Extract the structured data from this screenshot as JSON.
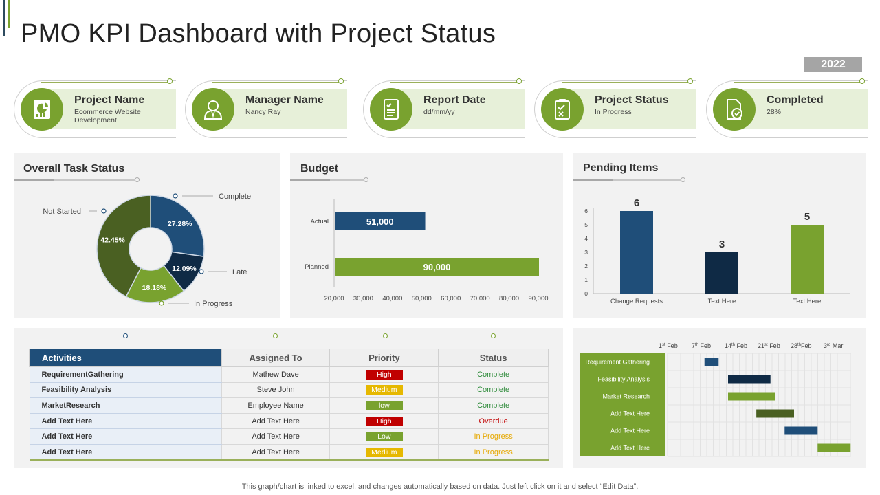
{
  "title": "PMO KPI Dashboard with Project Status",
  "year": "2022",
  "kpis": [
    {
      "title": "Project Name",
      "value": "Ecommerce Website Development",
      "icon": "pie-report-icon"
    },
    {
      "title": "Manager Name",
      "value": "Nancy Ray",
      "icon": "person-icon"
    },
    {
      "title": "Report Date",
      "value": "dd/mm/yy",
      "icon": "document-icon"
    },
    {
      "title": "Project Status",
      "value": "In Progress",
      "icon": "clipboard-check-icon"
    },
    {
      "title": "Completed",
      "value": "28%",
      "icon": "file-check-icon"
    }
  ],
  "overall": {
    "title": "Overall  Task Status"
  },
  "budget": {
    "title": "Budget"
  },
  "pending": {
    "title": "Pending Items"
  },
  "colors": {
    "green": "#79a22f",
    "navy": "#1f4e79",
    "darknavy": "#0f2a45",
    "olive": "#4a6022",
    "lightgreen": "#e7f0d9",
    "red": "#c00000",
    "amber": "#e6b800",
    "panel": "#f2f2f2"
  },
  "chart_data": [
    {
      "type": "pie",
      "title": "Overall  Task Status",
      "slices": [
        {
          "label": "Complete",
          "value": 27.28,
          "display": "27.28%",
          "color": "#1f4e79"
        },
        {
          "label": "Late",
          "value": 12.09,
          "display": "12.09%",
          "color": "#0f2a45"
        },
        {
          "label": "In Progress",
          "value": 18.18,
          "display": "18.18%",
          "color": "#79a22f"
        },
        {
          "label": "Not Started",
          "value": 42.45,
          "display": "42.45%",
          "color": "#4a6022"
        }
      ]
    },
    {
      "type": "bar",
      "orientation": "horizontal",
      "title": "Budget",
      "categories": [
        "Actual",
        "Planned"
      ],
      "values": [
        51000,
        90000
      ],
      "value_labels": [
        "51,000",
        "90,000"
      ],
      "colors": [
        "#1f4e79",
        "#79a22f"
      ],
      "xlim": [
        20000,
        90000
      ],
      "xticks": [
        "20,000",
        "30,000",
        "40,000",
        "50,000",
        "60,000",
        "70,000",
        "80,000",
        "90,000"
      ]
    },
    {
      "type": "bar",
      "title": "Pending Items",
      "categories": [
        "Change Requests",
        "Text Here",
        "Text Here"
      ],
      "values": [
        6,
        3,
        5
      ],
      "colors": [
        "#1f4e79",
        "#0f2a45",
        "#79a22f"
      ],
      "ylim": [
        0,
        6
      ],
      "yticks": [
        "0",
        "1",
        "2",
        "3",
        "4",
        "5",
        "6"
      ]
    },
    {
      "type": "gantt",
      "date_labels": [
        {
          "day": "1",
          "sup": "st",
          "mon": " Feb"
        },
        {
          "day": "7",
          "sup": "th",
          "mon": " Feb"
        },
        {
          "day": "14",
          "sup": "th",
          "mon": " Feb"
        },
        {
          "day": "21",
          "sup": "st",
          "mon": " Feb"
        },
        {
          "day": "28",
          "sup": "th",
          "mon": "Feb"
        },
        {
          "day": "3",
          "sup": "rd",
          "mon": " Mar"
        }
      ],
      "tasks": [
        {
          "label": "Requirement Gathering",
          "start": "2022-02-10",
          "end": "2022-02-13",
          "color": "#1f4e79"
        },
        {
          "label": "Feasibility Analysis",
          "start": "2022-02-15",
          "end": "2022-02-24",
          "color": "#0f2a45"
        },
        {
          "label": "Market Research",
          "start": "2022-02-15",
          "end": "2022-02-25",
          "color": "#79a22f"
        },
        {
          "label": "Add Text Here",
          "start": "2022-02-21",
          "end": "2022-02-29",
          "color": "#4a6022"
        },
        {
          "label": "Add Text Here",
          "start": "2022-02-27",
          "end": "2022-03-06",
          "color": "#1f4e79"
        },
        {
          "label": "Add Text Here",
          "start": "2022-03-06",
          "end": "2022-03-13",
          "color": "#79a22f"
        }
      ]
    }
  ],
  "table": {
    "headers": [
      "Activities",
      "Assigned To",
      "Priority",
      "Status"
    ],
    "rows": [
      {
        "activity": "RequirementGathering",
        "assigned": "Mathew Dave",
        "priority": "High",
        "priority_color": "#c00000",
        "status": "Complete",
        "status_color": "#2e8b3a"
      },
      {
        "activity": "Feasibility Analysis",
        "assigned": "Steve John",
        "priority": "Medium",
        "priority_color": "#e6b800",
        "status": "Complete",
        "status_color": "#2e8b3a"
      },
      {
        "activity": "MarketResearch",
        "assigned": "Employee  Name",
        "priority": "low",
        "priority_color": "#79a22f",
        "status": "Complete",
        "status_color": "#2e8b3a"
      },
      {
        "activity": "Add Text Here",
        "assigned": "Add Text Here",
        "priority": "High",
        "priority_color": "#c00000",
        "status": "Overdue",
        "status_color": "#c00000"
      },
      {
        "activity": "Add Text Here",
        "assigned": "Add Text Here",
        "priority": "Low",
        "priority_color": "#79a22f",
        "status": "In Progress",
        "status_color": "#e6a800"
      },
      {
        "activity": "Add Text Here",
        "assigned": "Add Text Here",
        "priority": "Medium",
        "priority_color": "#e6b800",
        "status": "In Progress",
        "status_color": "#e6a800"
      }
    ]
  },
  "footer": "This graph/chart is linked to excel,  and changes automatically based on data. Just left click on it and select “Edit Data”."
}
